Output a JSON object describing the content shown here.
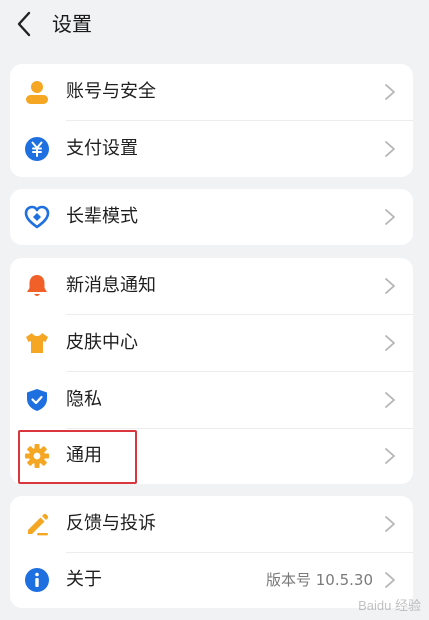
{
  "header": {
    "title": "设置"
  },
  "groups": [
    {
      "items": [
        {
          "label": "账号与安全",
          "icon": "user-icon"
        },
        {
          "label": "支付设置",
          "icon": "yuan-coin-icon"
        }
      ]
    },
    {
      "items": [
        {
          "label": "长辈模式",
          "icon": "heart-shield-icon"
        }
      ]
    },
    {
      "items": [
        {
          "label": "新消息通知",
          "icon": "bell-icon"
        },
        {
          "label": "皮肤中心",
          "icon": "tshirt-icon"
        },
        {
          "label": "隐私",
          "icon": "shield-check-icon"
        },
        {
          "label": "通用",
          "icon": "gear-icon"
        }
      ]
    },
    {
      "items": [
        {
          "label": "反馈与投诉",
          "icon": "pencil-icon"
        },
        {
          "label": "关于",
          "icon": "info-icon",
          "value": "版本号 10.5.30"
        }
      ]
    }
  ],
  "watermark": "Baidu 经验",
  "colors": {
    "orange": "#f5a623",
    "blue": "#1e6fe0",
    "red_orange": "#f2602a",
    "highlight": "#d9363e"
  }
}
